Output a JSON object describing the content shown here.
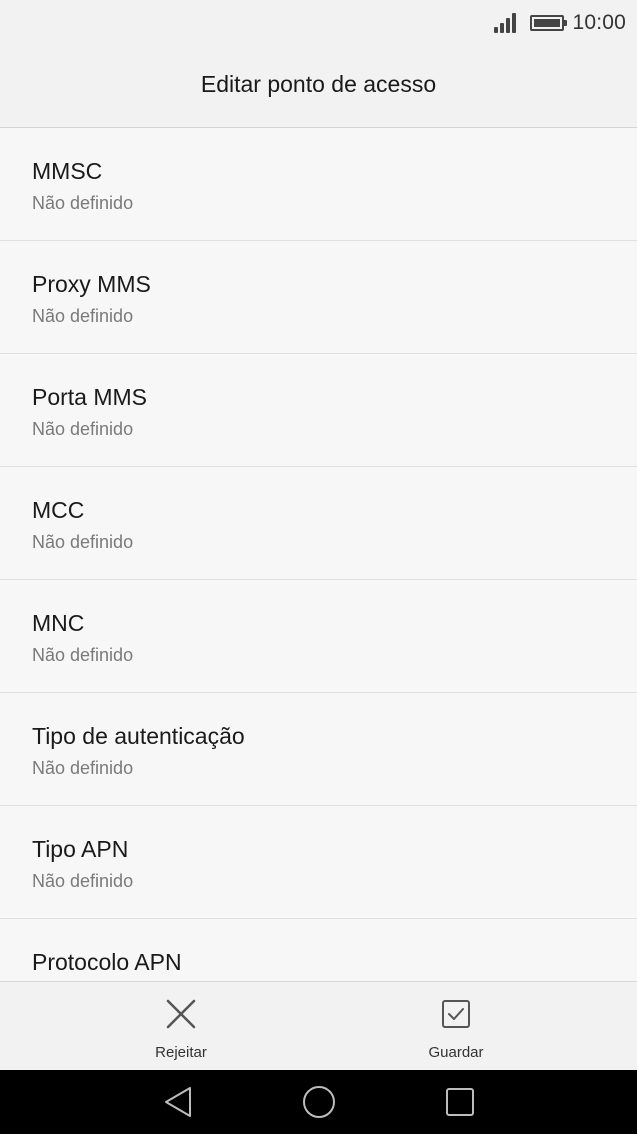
{
  "status_bar": {
    "time": "10:00",
    "signal_icon": "signal-icon",
    "battery_icon": "battery-icon"
  },
  "app_bar": {
    "title": "Editar ponto de acesso"
  },
  "list": {
    "items": [
      {
        "title": "MMSC",
        "value": "Não definido"
      },
      {
        "title": "Proxy MMS",
        "value": "Não definido"
      },
      {
        "title": "Porta MMS",
        "value": "Não definido"
      },
      {
        "title": "MCC",
        "value": "Não definido"
      },
      {
        "title": "MNC",
        "value": "Não definido"
      },
      {
        "title": "Tipo de autenticação",
        "value": "Não definido"
      },
      {
        "title": "Tipo APN",
        "value": "Não definido"
      },
      {
        "title": "Protocolo APN",
        "value": ""
      }
    ]
  },
  "toolbar": {
    "reject_label": "Rejeitar",
    "reject_icon": "close-icon",
    "save_label": "Guardar",
    "save_icon": "checkbox-icon"
  },
  "nav_bar": {
    "back_icon": "back-triangle-icon",
    "home_icon": "home-circle-icon",
    "recents_icon": "recents-square-icon"
  },
  "colors": {
    "background": "#f7f7f7",
    "bar_background": "#f2f2f2",
    "title_text": "#1a1a1a",
    "secondary_text": "#7a7a7a",
    "divider": "#e0e0e0",
    "nav_background": "#000000"
  }
}
